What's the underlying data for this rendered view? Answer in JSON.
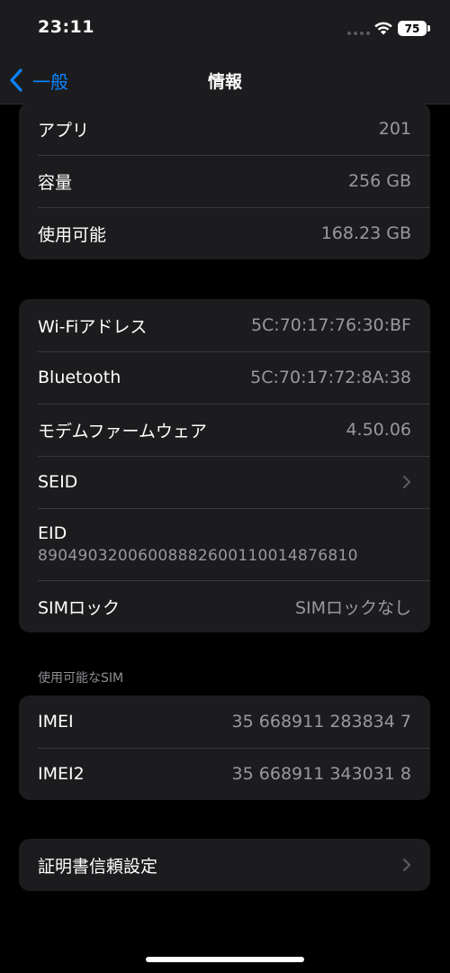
{
  "status_bar": {
    "time": "23:11",
    "battery": "75"
  },
  "nav": {
    "back_label": "一般",
    "title": "情報"
  },
  "group1": [
    {
      "label": "アプリ",
      "value": "201"
    },
    {
      "label": "容量",
      "value": "256 GB"
    },
    {
      "label": "使用可能",
      "value": "168.23 GB"
    }
  ],
  "group2": {
    "wifi": {
      "label": "Wi-Fiアドレス",
      "value": "5C:70:17:76:30:BF"
    },
    "bluetooth": {
      "label": "Bluetooth",
      "value": "5C:70:17:72:8A:38"
    },
    "modem": {
      "label": "モデムファームウェア",
      "value": "4.50.06"
    },
    "seid": {
      "label": "SEID"
    },
    "eid": {
      "label": "EID",
      "value": "89049032006008882600110014876810"
    },
    "simlock": {
      "label": "SIMロック",
      "value": "SIMロックなし"
    }
  },
  "sim_section": {
    "header": "使用可能なSIM",
    "rows": [
      {
        "label": "IMEI",
        "value": "35 668911 283834 7"
      },
      {
        "label": "IMEI2",
        "value": "35 668911 343031 8"
      }
    ]
  },
  "certificate": {
    "label": "証明書信頼設定"
  },
  "colors": {
    "accent": "#0a84ff",
    "background": "#000000",
    "cell": "#1c1c1e",
    "secondary_text": "#98989f"
  },
  "icons": [
    "wifi-icon",
    "battery-icon",
    "back-chevron-icon",
    "chevron-right-icon"
  ]
}
